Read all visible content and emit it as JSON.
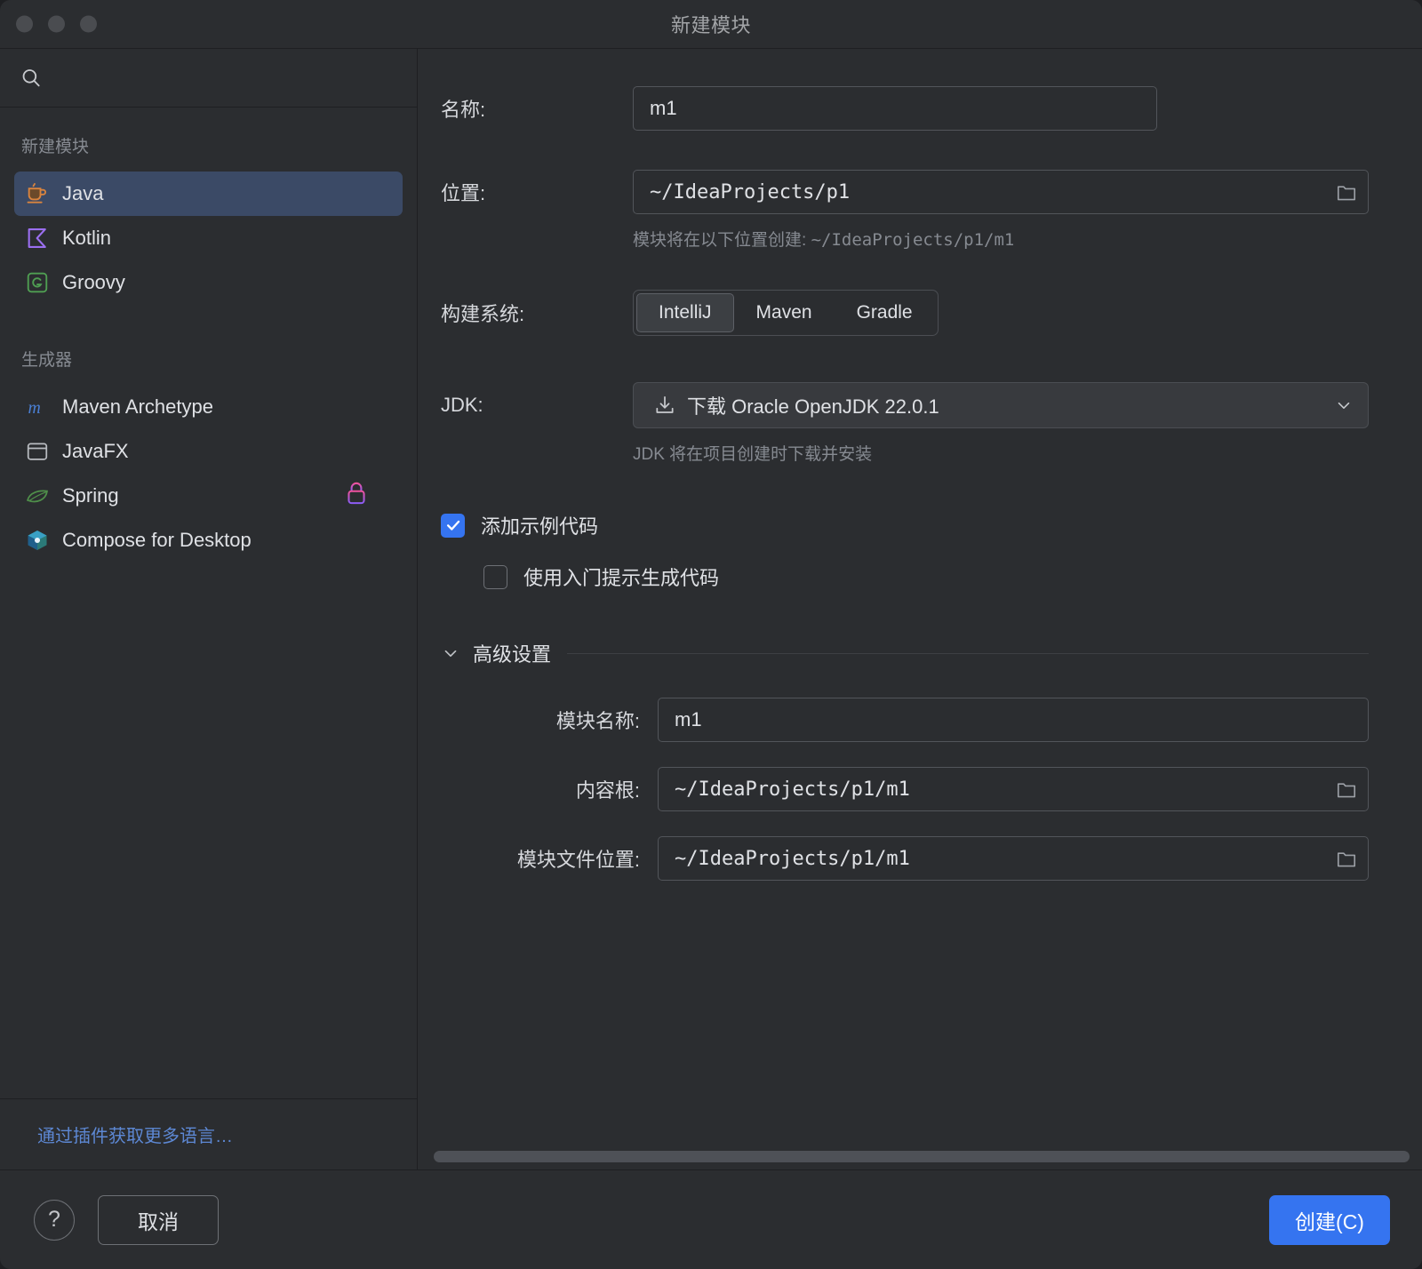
{
  "window": {
    "title": "新建模块",
    "traffic_lights": [
      "close",
      "minimize",
      "maximize"
    ]
  },
  "sidebar": {
    "search": {
      "value": "",
      "placeholder": ""
    },
    "groups": [
      {
        "title": "新建模块",
        "items": [
          {
            "label": "Java",
            "icon": "java-coffee-cup-icon",
            "selected": true,
            "locked": false
          },
          {
            "label": "Kotlin",
            "icon": "kotlin-icon",
            "selected": false,
            "locked": false
          },
          {
            "label": "Groovy",
            "icon": "groovy-icon",
            "selected": false,
            "locked": false
          }
        ]
      },
      {
        "title": "生成器",
        "items": [
          {
            "label": "Maven Archetype",
            "icon": "maven-m-icon",
            "selected": false,
            "locked": false
          },
          {
            "label": "JavaFX",
            "icon": "javafx-window-icon",
            "selected": false,
            "locked": false
          },
          {
            "label": "Spring",
            "icon": "spring-leaf-icon",
            "selected": false,
            "locked": true
          },
          {
            "label": "Compose for Desktop",
            "icon": "compose-cube-icon",
            "selected": false,
            "locked": false
          }
        ]
      }
    ],
    "plugin_link": "通过插件获取更多语言…"
  },
  "form": {
    "name_label": "名称:",
    "name_value": "m1",
    "location_label": "位置:",
    "location_value": "~/IdeaProjects/p1",
    "location_hint_prefix": "模块将在以下位置创建: ",
    "location_hint_path": "~/IdeaProjects/p1/m1",
    "build_system_label": "构建系统:",
    "build_systems": [
      "IntelliJ",
      "Maven",
      "Gradle"
    ],
    "build_system_selected": "IntelliJ",
    "jdk_label": "JDK:",
    "jdk_value": "下载 Oracle OpenJDK 22.0.1",
    "jdk_hint": "JDK 将在项目创建时下载并安装",
    "checkbox_sample_code": {
      "label": "添加示例代码",
      "checked": true
    },
    "checkbox_onboarding_tips": {
      "label": "使用入门提示生成代码",
      "checked": false
    },
    "advanced": {
      "title": "高级设置",
      "expanded": true,
      "module_name_label": "模块名称:",
      "module_name_value": "m1",
      "content_root_label": "内容根:",
      "content_root_value": "~/IdeaProjects/p1/m1",
      "module_file_label": "模块文件位置:",
      "module_file_value": "~/IdeaProjects/p1/m1"
    }
  },
  "footer": {
    "help_label": "?",
    "cancel_label": "取消",
    "create_label": "创建(C)"
  },
  "colors": {
    "accent": "#3574f0",
    "selection": "#3b4a66",
    "link": "#5d88d4",
    "window_bg": "#2b2d30",
    "border": "#1e1f22"
  }
}
